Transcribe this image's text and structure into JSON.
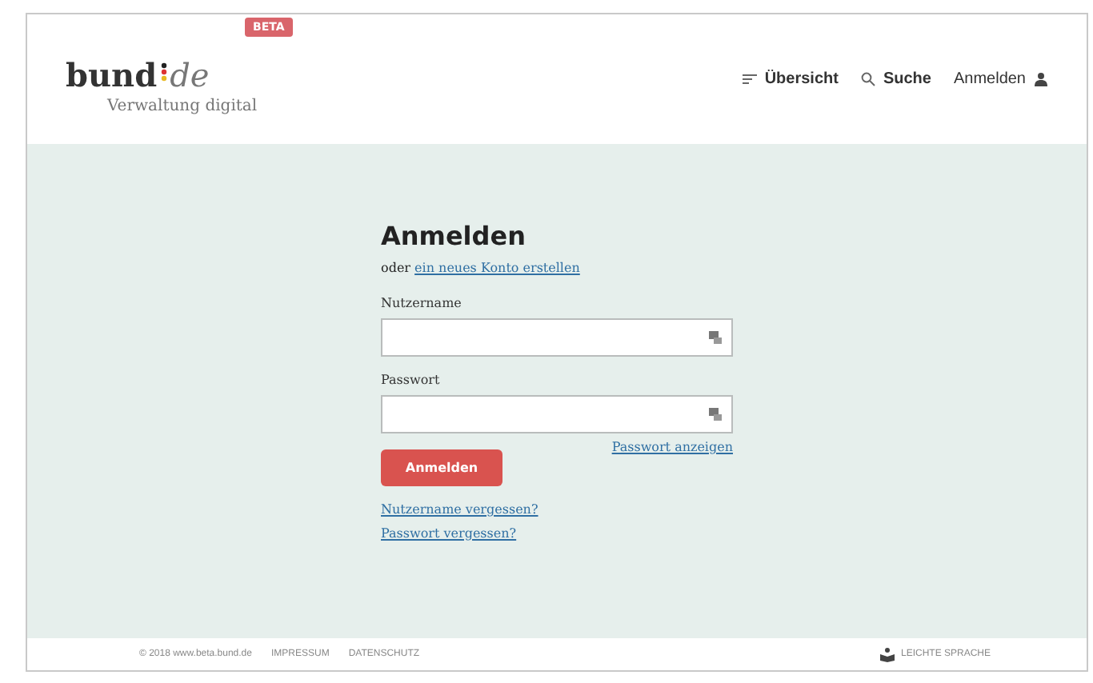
{
  "logo": {
    "name": "bund",
    "suffix": "de",
    "tagline": "Verwaltung digital",
    "badge": "BETA"
  },
  "nav": [
    {
      "kind": "menu",
      "label": "Übersicht"
    },
    {
      "kind": "search",
      "label": "Suche"
    },
    {
      "kind": "user",
      "label": "Anmelden"
    }
  ],
  "login": {
    "title": "Anmelden",
    "intro": "oder",
    "register_link": "ein neues Konto erstellen",
    "fields": [
      {
        "label": "Nutzername"
      },
      {
        "label": "Passwort"
      }
    ],
    "show_password": "Passwort anzeigen",
    "submit": "Anmelden",
    "links": [
      "Nutzername vergessen?",
      "Passwort vergessen?"
    ]
  },
  "footer": {
    "copyright": "© 2018 www.beta.bund.de",
    "links": [
      "IMPRESSUM",
      "DATENSCHUTZ"
    ],
    "easy_language": "LEICHTE SPRACHE"
  }
}
